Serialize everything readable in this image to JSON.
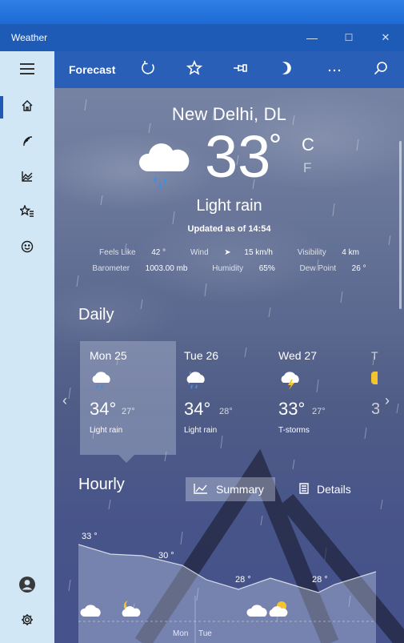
{
  "window": {
    "title": "Weather"
  },
  "titlebar": {
    "minimize": "—",
    "maximize": "☐",
    "close": "✕"
  },
  "toolbar": {
    "title": "Forecast"
  },
  "sidebar": {
    "items": [
      {
        "name": "menu",
        "icon": "hamburger-icon"
      },
      {
        "name": "forecast",
        "icon": "home-icon",
        "active": true
      },
      {
        "name": "maps",
        "icon": "radar-icon"
      },
      {
        "name": "historical",
        "icon": "chart-icon"
      },
      {
        "name": "places",
        "icon": "favorites-icon"
      },
      {
        "name": "news",
        "icon": "smiley-icon"
      },
      {
        "name": "account",
        "icon": "avatar-icon"
      },
      {
        "name": "settings",
        "icon": "gear-icon"
      }
    ]
  },
  "current": {
    "city": "New Delhi, DL",
    "temp": "33",
    "deg": "°",
    "unit_c": "C",
    "unit_f": "F",
    "condition": "Light rain",
    "updated": "Updated as of 14:54",
    "feels_like_label": "Feels Like",
    "feels_like": "42 °",
    "wind_label": "Wind",
    "wind": "15 km/h",
    "visibility_label": "Visibility",
    "visibility": "4 km",
    "barometer_label": "Barometer",
    "barometer": "1003.00 mb",
    "humidity_label": "Humidity",
    "humidity": "65%",
    "dewpoint_label": "Dew Point",
    "dewpoint": "26 °"
  },
  "daily": {
    "title": "Daily",
    "days": [
      {
        "name": "Mon 25",
        "hi": "34°",
        "lo": "27°",
        "desc": "Light rain",
        "icon": "rain-cloud-icon"
      },
      {
        "name": "Tue 26",
        "hi": "34°",
        "lo": "28°",
        "desc": "Light rain",
        "icon": "rain-cloud-icon"
      },
      {
        "name": "Wed 27",
        "hi": "33°",
        "lo": "27°",
        "desc": "T-storms",
        "icon": "thunderstorm-icon"
      }
    ]
  },
  "hourly": {
    "title": "Hourly",
    "summary_label": "Summary",
    "details_label": "Details",
    "temps": [
      "33 °",
      "30 °",
      "28 °",
      "28 °"
    ],
    "day_labels": [
      "Mon",
      "Tue"
    ]
  },
  "colors": {
    "titlebar": "#1e5bb7",
    "toolbar": "#2a5fb8",
    "sidebar": "#d1e7f5"
  }
}
